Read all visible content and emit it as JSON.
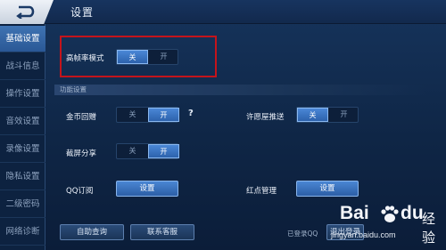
{
  "header": {
    "title": "设置",
    "back_icon": "back-arrow-icon"
  },
  "sidebar": {
    "items": [
      {
        "label": "基础设置",
        "active": true
      },
      {
        "label": "战斗信息",
        "active": false
      },
      {
        "label": "操作设置",
        "active": false
      },
      {
        "label": "音效设置",
        "active": false
      },
      {
        "label": "录像设置",
        "active": false
      },
      {
        "label": "隐私设置",
        "active": false
      },
      {
        "label": "二级密码",
        "active": false
      },
      {
        "label": "网络诊断",
        "active": false
      }
    ]
  },
  "high_frame": {
    "label": "高帧率模式",
    "off": "关",
    "on": "开",
    "selected": "off"
  },
  "section": {
    "title": "功能设置"
  },
  "coin_gift": {
    "label": "金币回赠",
    "off": "关",
    "on": "开",
    "selected": "on",
    "help": "?"
  },
  "wish_push": {
    "label": "许愿屋推送",
    "off": "关",
    "on": "开",
    "selected": "off"
  },
  "screenshot_share": {
    "label": "截屏分享",
    "off": "关",
    "on": "开",
    "selected": "on"
  },
  "qq_subscribe": {
    "label": "QQ订阅",
    "button": "设置"
  },
  "red_dot": {
    "label": "红点管理",
    "button": "设置"
  },
  "footer": {
    "self_help": "自助查询",
    "contact": "联系客服",
    "login_status": "已登录QQ",
    "logout_partial": "退出登录"
  },
  "watermark": {
    "brand": "Bai",
    "brand_end": "du",
    "sub": "经验",
    "url": "jingyan.baidu.com"
  },
  "colors": {
    "accent": "#3a72c2",
    "highlight_box": "#c4141b",
    "sidebar_active": "#3f73b3"
  }
}
